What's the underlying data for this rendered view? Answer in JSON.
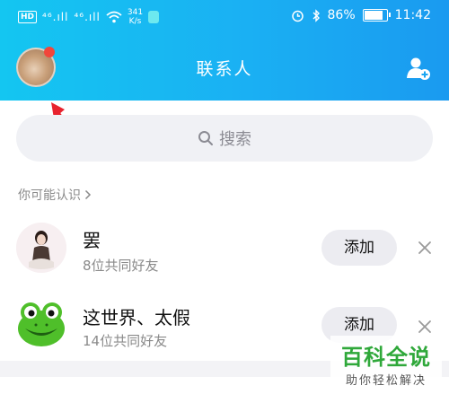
{
  "status_bar": {
    "network_badge": "HD",
    "signal_1": "⁴⁶.ıll",
    "signal_2": "⁴⁶.ıll",
    "speed_value": "341",
    "speed_unit": "K/s",
    "battery": "86%",
    "battery_level": 0.86,
    "time": "11:42"
  },
  "header": {
    "title": "联系人"
  },
  "search": {
    "placeholder": "搜索"
  },
  "recommend": {
    "section_label": "你可能认识",
    "items": [
      {
        "name": "罢",
        "mutual": "8位共同好友",
        "action": "添加"
      },
      {
        "name": "这世界、太假",
        "mutual": "14位共同好友",
        "action": "添加"
      }
    ]
  },
  "watermark": {
    "title": "百科全说",
    "subtitle": "助你轻松解决"
  },
  "colors": {
    "header_start": "#14c6f1",
    "header_end": "#1a9af0",
    "arrow": "#e8232e",
    "badge": "#f2463b",
    "watermark_green": "#2fa83a"
  }
}
